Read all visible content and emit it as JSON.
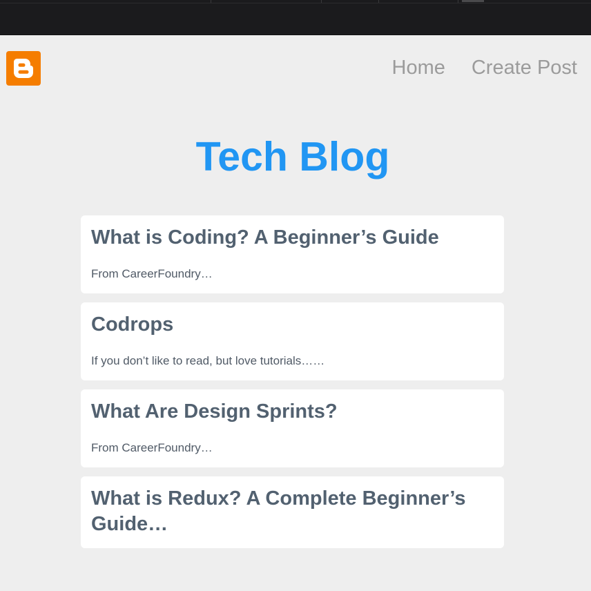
{
  "nav": {
    "logo_icon": "blogger-logo-icon",
    "brand_color": "#f57d00",
    "links": [
      {
        "label": "Home"
      },
      {
        "label": "Create Post"
      }
    ]
  },
  "page": {
    "title": "Tech Blog",
    "title_color": "#2196f3"
  },
  "posts": [
    {
      "title": "What is Coding? A Beginner’s Guide",
      "excerpt": "From CareerFoundry…"
    },
    {
      "title": "Codrops",
      "excerpt": "If you don’t like to read, but love tutorials……"
    },
    {
      "title": "What Are Design Sprints?",
      "excerpt": "From CareerFoundry…"
    },
    {
      "title": "What is Redux? A Complete Beginner’s Guide…",
      "excerpt": ""
    }
  ]
}
